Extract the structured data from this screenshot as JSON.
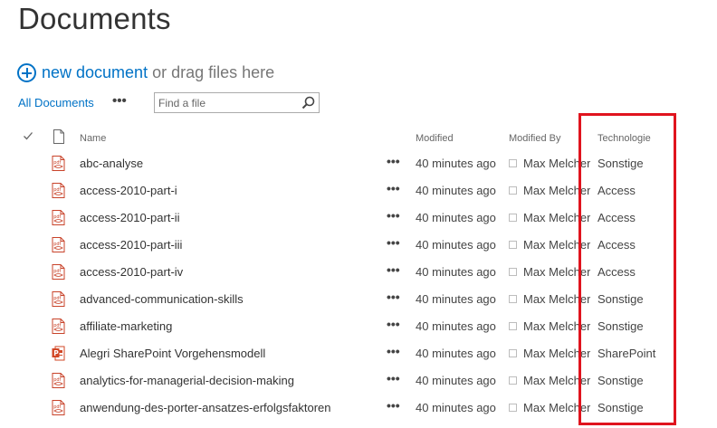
{
  "page": {
    "title": "Documents"
  },
  "new_document": {
    "link_label": "new document",
    "drag_text": "or drag files here"
  },
  "view": {
    "label": "All Documents",
    "more_label": "•••"
  },
  "search": {
    "placeholder": "Find a file"
  },
  "columns": {
    "name": "Name",
    "modified": "Modified",
    "modified_by": "Modified By",
    "technologie": "Technologie"
  },
  "row_menu_label": "•••",
  "colors": {
    "accent": "#0072c6",
    "highlight": "#e0141e",
    "pdf_icon": "#c8432a",
    "ppt_icon": "#d24726"
  },
  "files": [
    {
      "name": "abc-analyse",
      "modified": "40 minutes ago",
      "modified_by": "Max Melcher",
      "technologie": "Sonstige",
      "icon": "pdf-icon"
    },
    {
      "name": "access-2010-part-i",
      "modified": "40 minutes ago",
      "modified_by": "Max Melcher",
      "technologie": "Access",
      "icon": "pdf-icon"
    },
    {
      "name": "access-2010-part-ii",
      "modified": "40 minutes ago",
      "modified_by": "Max Melcher",
      "technologie": "Access",
      "icon": "pdf-icon"
    },
    {
      "name": "access-2010-part-iii",
      "modified": "40 minutes ago",
      "modified_by": "Max Melcher",
      "technologie": "Access",
      "icon": "pdf-icon"
    },
    {
      "name": "access-2010-part-iv",
      "modified": "40 minutes ago",
      "modified_by": "Max Melcher",
      "technologie": "Access",
      "icon": "pdf-icon"
    },
    {
      "name": "advanced-communication-skills",
      "modified": "40 minutes ago",
      "modified_by": "Max Melcher",
      "technologie": "Sonstige",
      "icon": "pdf-icon"
    },
    {
      "name": "affiliate-marketing",
      "modified": "40 minutes ago",
      "modified_by": "Max Melcher",
      "technologie": "Sonstige",
      "icon": "pdf-icon"
    },
    {
      "name": "Alegri SharePoint Vorgehensmodell",
      "modified": "40 minutes ago",
      "modified_by": "Max Melcher",
      "technologie": "SharePoint",
      "icon": "powerpoint-icon"
    },
    {
      "name": "analytics-for-managerial-decision-making",
      "modified": "40 minutes ago",
      "modified_by": "Max Melcher",
      "technologie": "Sonstige",
      "icon": "pdf-icon"
    },
    {
      "name": "anwendung-des-porter-ansatzes-erfolgsfaktoren",
      "modified": "40 minutes ago",
      "modified_by": "Max Melcher",
      "technologie": "Sonstige",
      "icon": "pdf-icon"
    }
  ]
}
